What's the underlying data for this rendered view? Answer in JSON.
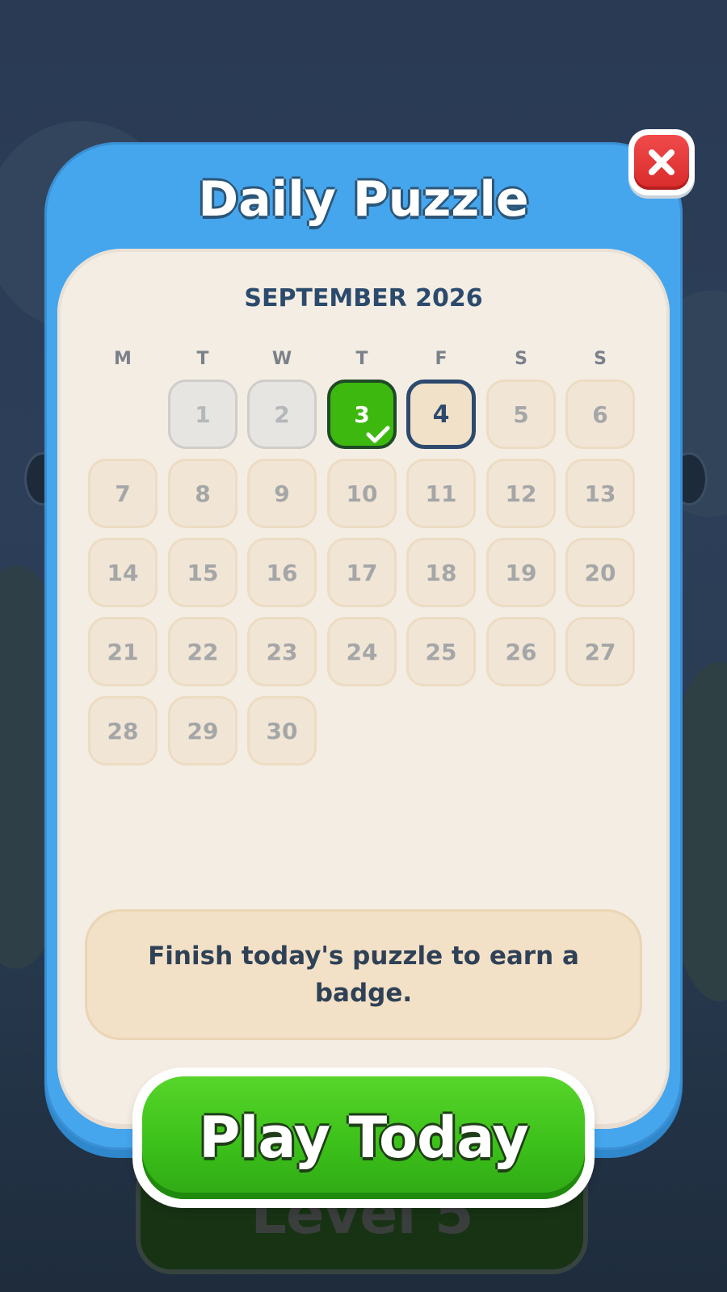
{
  "modal": {
    "title": "Daily Puzzle",
    "close_icon": "close-icon"
  },
  "calendar": {
    "month_label": "SEPTEMBER 2026",
    "weekdays": [
      "M",
      "T",
      "W",
      "T",
      "F",
      "S",
      "S"
    ],
    "days": [
      {
        "label": "1",
        "state": "past"
      },
      {
        "label": "2",
        "state": "past"
      },
      {
        "label": "3",
        "state": "completed",
        "icon": "check-icon"
      },
      {
        "label": "4",
        "state": "today"
      },
      {
        "label": "5",
        "state": "locked"
      },
      {
        "label": "6",
        "state": "locked"
      },
      {
        "label": "7",
        "state": "locked"
      },
      {
        "label": "8",
        "state": "locked"
      },
      {
        "label": "9",
        "state": "locked"
      },
      {
        "label": "10",
        "state": "locked"
      },
      {
        "label": "11",
        "state": "locked"
      },
      {
        "label": "12",
        "state": "locked"
      },
      {
        "label": "13",
        "state": "locked"
      },
      {
        "label": "14",
        "state": "locked"
      },
      {
        "label": "15",
        "state": "locked"
      },
      {
        "label": "16",
        "state": "locked"
      },
      {
        "label": "17",
        "state": "locked"
      },
      {
        "label": "18",
        "state": "locked"
      },
      {
        "label": "19",
        "state": "locked"
      },
      {
        "label": "20",
        "state": "locked"
      },
      {
        "label": "21",
        "state": "locked"
      },
      {
        "label": "22",
        "state": "locked"
      },
      {
        "label": "23",
        "state": "locked"
      },
      {
        "label": "24",
        "state": "locked"
      },
      {
        "label": "25",
        "state": "locked"
      },
      {
        "label": "26",
        "state": "locked"
      },
      {
        "label": "27",
        "state": "locked"
      },
      {
        "label": "28",
        "state": "locked"
      },
      {
        "label": "29",
        "state": "locked"
      },
      {
        "label": "30",
        "state": "locked"
      }
    ]
  },
  "message": {
    "text": "Finish today's puzzle to earn a badge."
  },
  "play_button": {
    "label": "Play Today"
  },
  "background": {
    "level_button_label": "Level 5"
  },
  "colors": {
    "modal_frame": "#45a6ee",
    "panel": "#f4ede3",
    "completed_day": "#3cb80f",
    "today_border": "#2d4a6e",
    "play_button": "#3cc11a",
    "close_button": "#e03535"
  }
}
